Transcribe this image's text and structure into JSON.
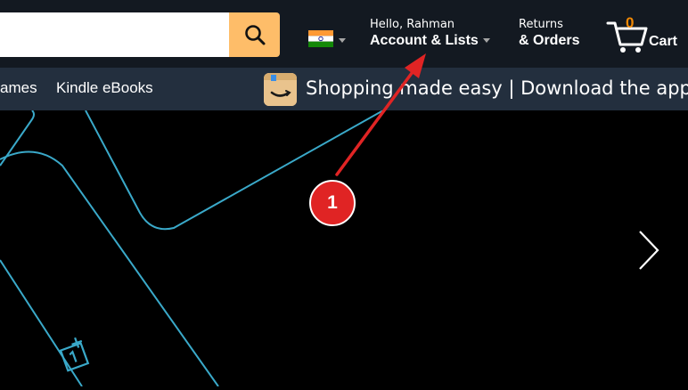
{
  "header": {
    "search": {
      "placeholder": "",
      "icon": "search-icon"
    },
    "country_flag": "india-flag-icon",
    "account": {
      "greeting": "Hello, Rahman",
      "label": "Account & Lists"
    },
    "orders": {
      "line1": "Returns",
      "line2": "& Orders"
    },
    "cart": {
      "count": "0",
      "label": "Cart"
    }
  },
  "navbar": {
    "items": [
      "ames",
      "Kindle eBooks"
    ],
    "promo": "Shopping made easy | Download the app"
  },
  "annotation": {
    "number": "1"
  },
  "colors": {
    "topbar": "#131921",
    "navbar": "#232f3e",
    "search_button": "#febd69",
    "cart_count": "#f08804",
    "hero_line": "#3aa9c9",
    "annotation": "#e02424"
  }
}
